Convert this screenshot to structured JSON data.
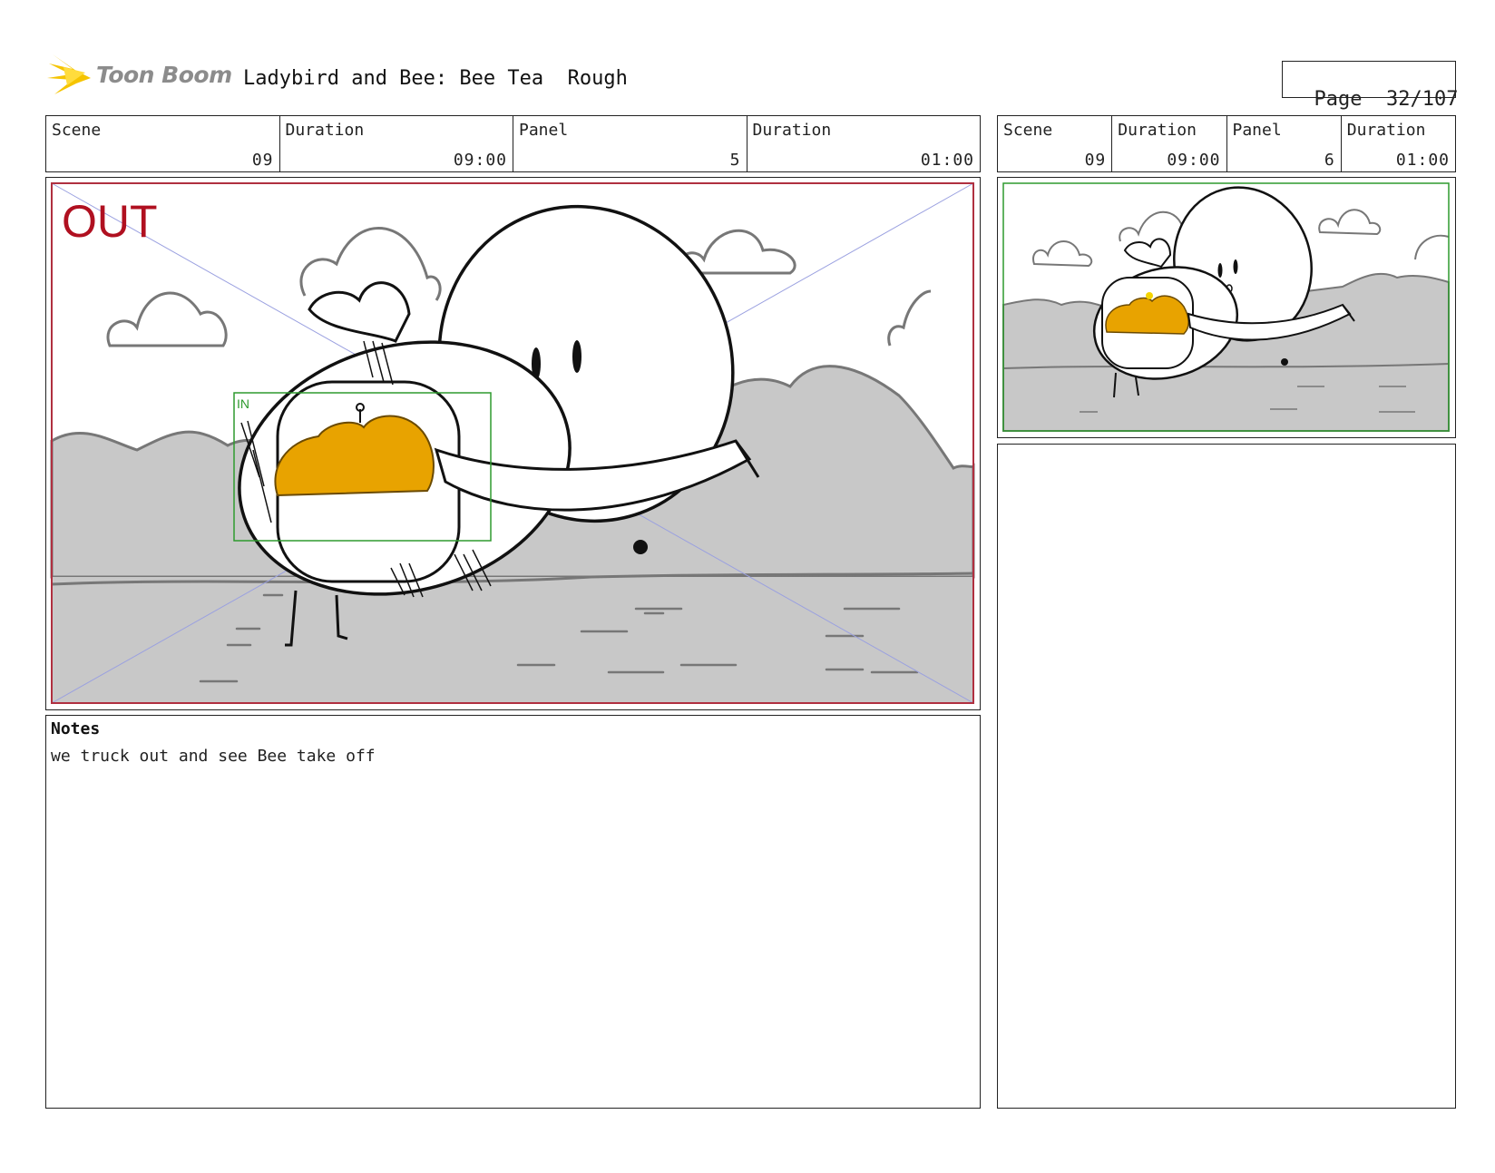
{
  "header": {
    "logo_text": "Toon Boom",
    "title": "Ladybird and Bee: Bee Tea  Rough",
    "page_label": "Page",
    "page_value": "32/107"
  },
  "panel_main": {
    "scene_label": "Scene",
    "scene_value": "09",
    "scene_duration_label": "Duration",
    "scene_duration_value": "09:00",
    "panel_label": "Panel",
    "panel_value": "5",
    "panel_duration_label": "Duration",
    "panel_duration_value": "01:00",
    "out_label": "OUT",
    "in_label": "IN"
  },
  "panel_next": {
    "scene_label": "Scene",
    "scene_value": "09",
    "scene_duration_label": "Duration",
    "scene_duration_value": "09:00",
    "panel_label": "Panel",
    "panel_value": "6",
    "panel_duration_label": "Duration",
    "panel_duration_value": "01:00"
  },
  "notes": {
    "title": "Notes",
    "text": "we truck out and see Bee take off"
  },
  "colors": {
    "honey": "#e8a300",
    "out_frame": "#b03040",
    "in_frame": "#2e9a2e",
    "ground": "#c8c8c8"
  }
}
